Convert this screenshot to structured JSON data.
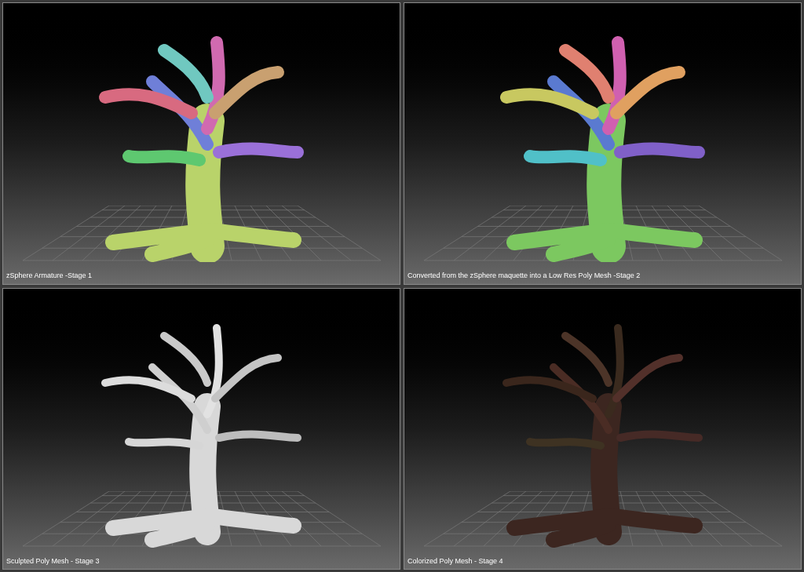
{
  "panels": [
    {
      "kind": "armature",
      "caption": "zSphere Armature -Stage 1"
    },
    {
      "kind": "lowpoly",
      "caption": "Converted from the zSphere maquette into a Low Res Poly Mesh -Stage 2"
    },
    {
      "kind": "sculpted",
      "caption": "Sculpted Poly Mesh - Stage 3"
    },
    {
      "kind": "colorized",
      "caption": "Colorized Poly Mesh - Stage 4"
    }
  ]
}
